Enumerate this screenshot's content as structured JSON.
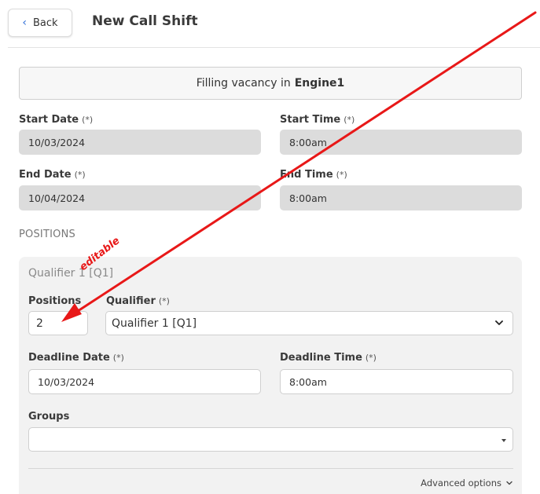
{
  "header": {
    "back_label": "Back",
    "title": "New Call Shift"
  },
  "banner": {
    "prefix": "Filling vacancy in",
    "unit": "Engine1"
  },
  "schedule": {
    "start_date": {
      "label": "Start Date",
      "req": "(*)",
      "value": "10/03/2024"
    },
    "start_time": {
      "label": "Start Time",
      "req": "(*)",
      "value": "8:00am"
    },
    "end_date": {
      "label": "End Date",
      "req": "(*)",
      "value": "10/04/2024"
    },
    "end_time": {
      "label": "End Time",
      "req": "(*)",
      "value": "8:00am"
    }
  },
  "positions_section": {
    "title": "POSITIONS",
    "panel_title": "Qualifier 1 [Q1]",
    "positions": {
      "label": "Positions",
      "value": "2"
    },
    "qualifier": {
      "label": "Qualifier",
      "req": "(*)",
      "value": "Qualifier 1 [Q1]"
    },
    "deadline_date": {
      "label": "Deadline Date",
      "req": "(*)",
      "value": "10/03/2024"
    },
    "deadline_time": {
      "label": "Deadline Time",
      "req": "(*)",
      "value": "8:00am"
    },
    "groups": {
      "label": "Groups",
      "value": ""
    },
    "advanced_label": "Advanced options"
  },
  "annotation": {
    "text": "editable",
    "color": "#e81818"
  },
  "colors": {
    "accent": "#2f6fd8",
    "readonly_bg": "#dcdcdc",
    "panel_bg": "#f2f2f2"
  },
  "icons": {
    "back": "chevron-left-icon",
    "select": "chevron-down-icon",
    "groups": "caret-down-icon",
    "advanced": "chevron-down-icon"
  }
}
